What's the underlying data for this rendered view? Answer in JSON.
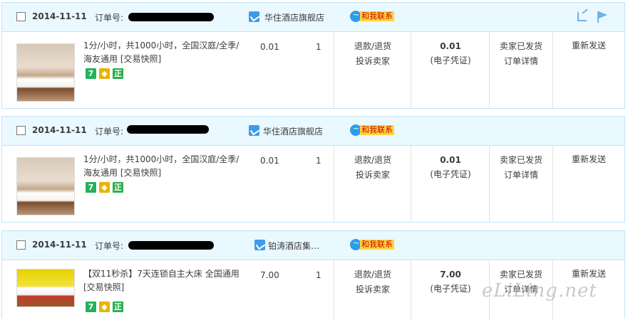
{
  "orders": [
    {
      "date": "2014-11-11",
      "order_no_label": "订单号:",
      "store": "华住酒店旗舰店",
      "contact": "和我联系",
      "title": "1分/小时，共1000小时，全国汉庭/全季/海友通用 [交易快照]",
      "price": "0.01",
      "qty": "1",
      "refund": "退款/退货",
      "complain": "投诉卖家",
      "total": "0.01",
      "total_note": "(电子凭证)",
      "status": "卖家已发货",
      "detail": "订单详情",
      "resend": "重新发送"
    },
    {
      "date": "2014-11-11",
      "order_no_label": "订单号:",
      "store": "华住酒店旗舰店",
      "contact": "和我联系",
      "title": "1分/小时，共1000小时，全国汉庭/全季/海友通用 [交易快照]",
      "price": "0.01",
      "qty": "1",
      "refund": "退款/退货",
      "complain": "投诉卖家",
      "total": "0.01",
      "total_note": "(电子凭证)",
      "status": "卖家已发货",
      "detail": "订单详情",
      "resend": "重新发送"
    },
    {
      "date": "2014-11-11",
      "order_no_label": "订单号:",
      "store": "铂涛酒店集…",
      "contact": "和我联系",
      "title": "【双11秒杀】7天连锁自主大床 全国通用 [交易快照]",
      "price": "7.00",
      "qty": "1",
      "refund": "退款/退货",
      "complain": "投诉卖家",
      "total": "7.00",
      "total_note": "(电子凭证)",
      "status": "卖家已发货",
      "detail": "订单详情",
      "resend": "重新发送"
    }
  ],
  "badges": {
    "seven": "7",
    "zheng": "正"
  },
  "watermark": "eLiLing.net"
}
